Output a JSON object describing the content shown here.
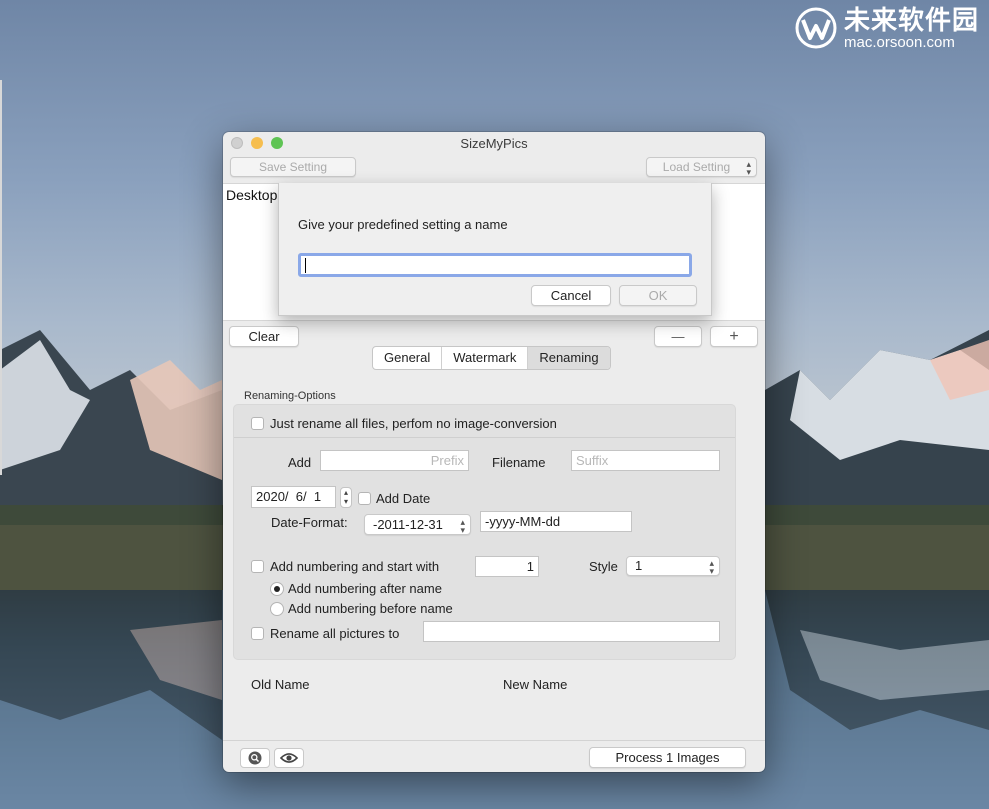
{
  "watermark": {
    "cn": "未来软件园",
    "url": "mac.orsoon.com"
  },
  "window": {
    "title": "SizeMyPics",
    "save_setting": "Save Setting",
    "load_setting": "Load Setting",
    "file_list_item": "Desktop,"
  },
  "toolbar": {
    "clear": "Clear",
    "minus": "—",
    "plus": "+"
  },
  "tabs": [
    {
      "label": "General",
      "active": false
    },
    {
      "label": "Watermark",
      "active": false
    },
    {
      "label": "Renaming",
      "active": true
    }
  ],
  "renaming": {
    "section_label": "Renaming-Options",
    "just_rename": {
      "label": "Just rename all files, perfom no image-conversion",
      "checked": false
    },
    "add_label": "Add",
    "prefix_placeholder": "Prefix",
    "filename_label": "Filename",
    "suffix_placeholder": "Suffix",
    "date_value": "2020/  6/  1",
    "add_date": {
      "label": "Add Date",
      "checked": false
    },
    "date_format_label": "Date-Format:",
    "date_format_select": "-2011-12-31",
    "date_format_text": "-yyyy-MM-dd",
    "numbering": {
      "label": "Add numbering and start with",
      "checked": false,
      "start": "1"
    },
    "style_label": "Style",
    "style_value": "1",
    "after_name": {
      "label": "Add numbering after name",
      "selected": true
    },
    "before_name": {
      "label": "Add numbering before name",
      "selected": false
    },
    "rename_all": {
      "label": "Rename all pictures to",
      "checked": false,
      "value": ""
    }
  },
  "columns": {
    "old_name": "Old Name",
    "new_name": "New Name"
  },
  "bottom": {
    "process_button": "Process 1 Images"
  },
  "sheet": {
    "message": "Give your predefined setting a name",
    "input_value": "",
    "cancel": "Cancel",
    "ok": "OK"
  },
  "colors": {
    "focus_ring": "#8aa8e8",
    "window_bg": "#ececec"
  },
  "icons": [
    "zoom-icon",
    "eye-icon",
    "stepper-arrows-icon"
  ]
}
